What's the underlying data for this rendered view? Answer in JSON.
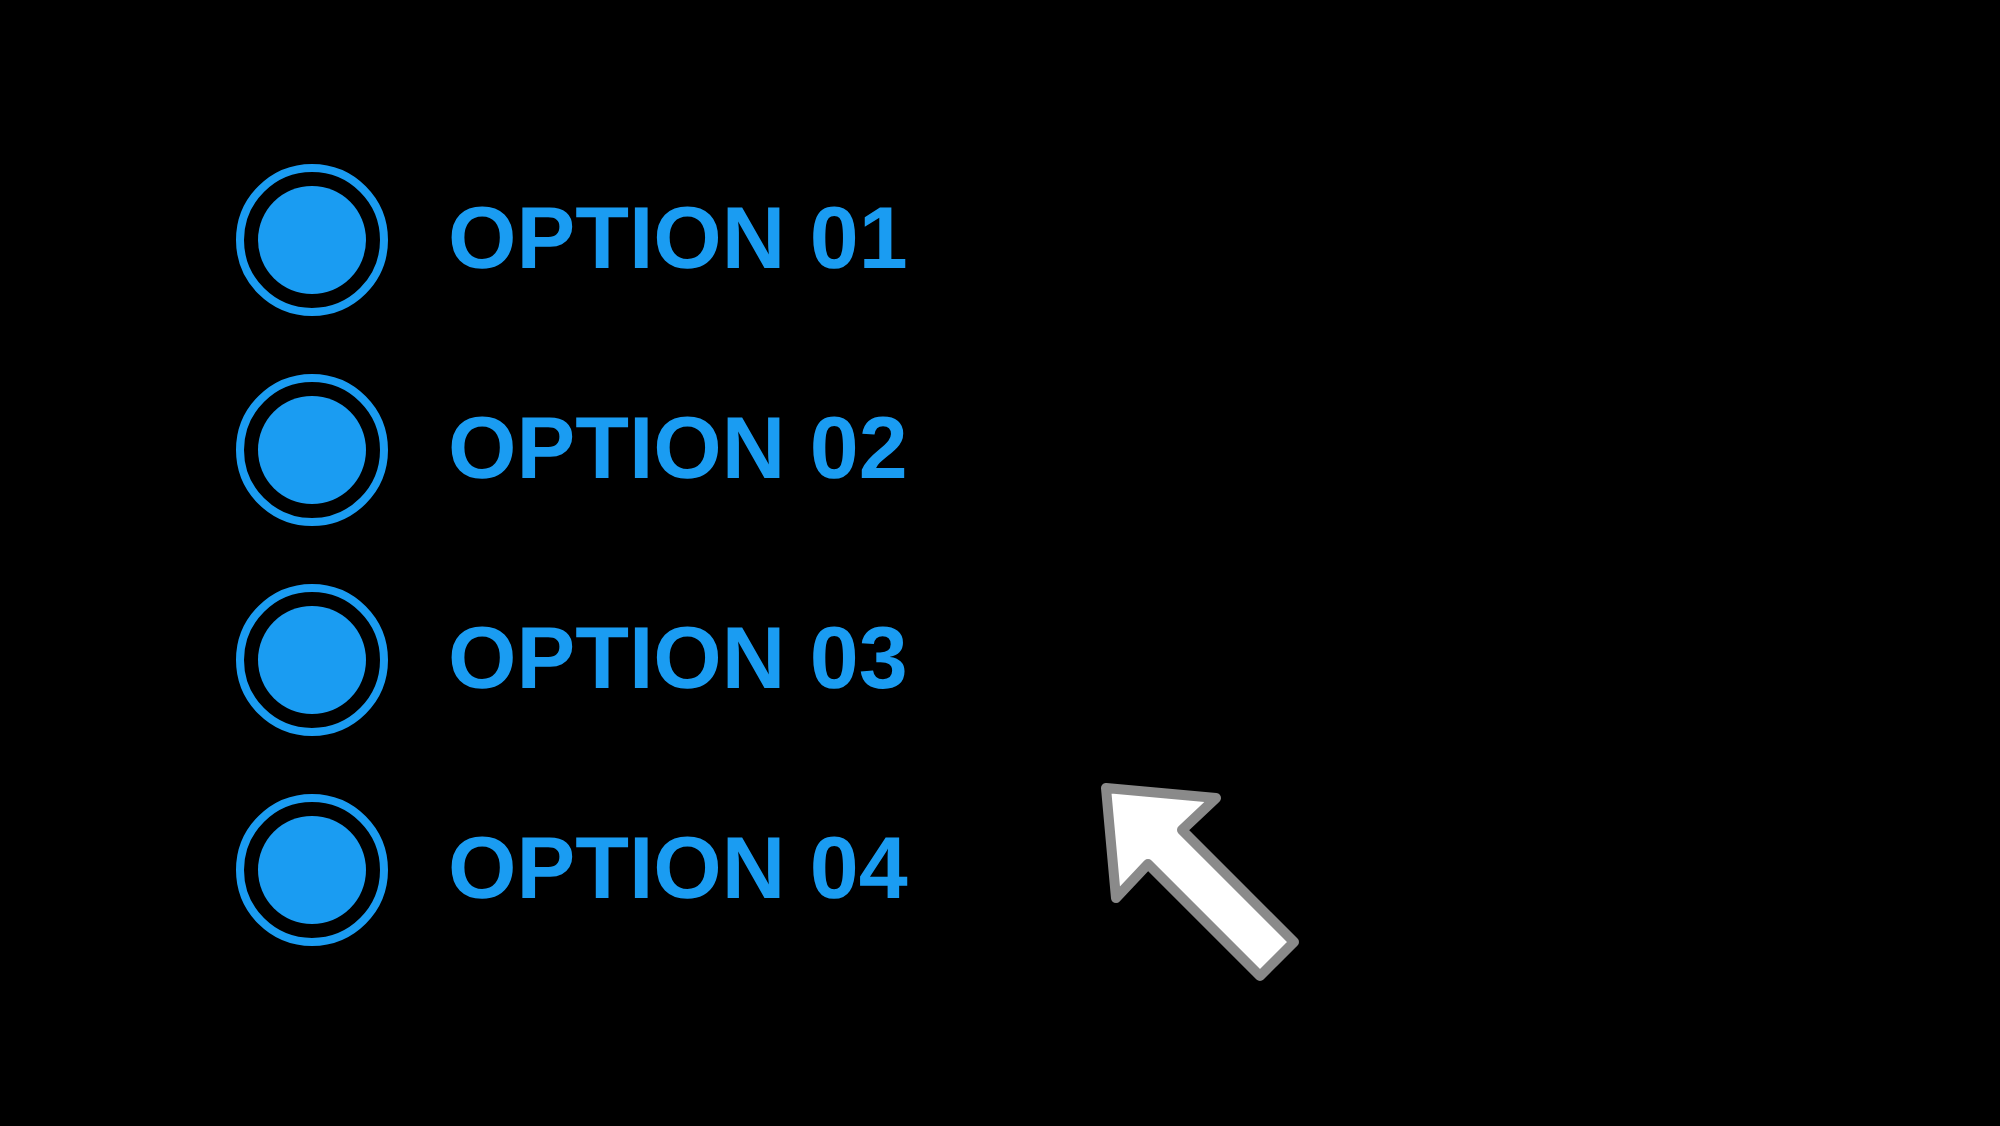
{
  "options": [
    {
      "label": "OPTION 01",
      "selected": true
    },
    {
      "label": "OPTION 02",
      "selected": true
    },
    {
      "label": "OPTION 03",
      "selected": true
    },
    {
      "label": "OPTION 04",
      "selected": true
    }
  ]
}
